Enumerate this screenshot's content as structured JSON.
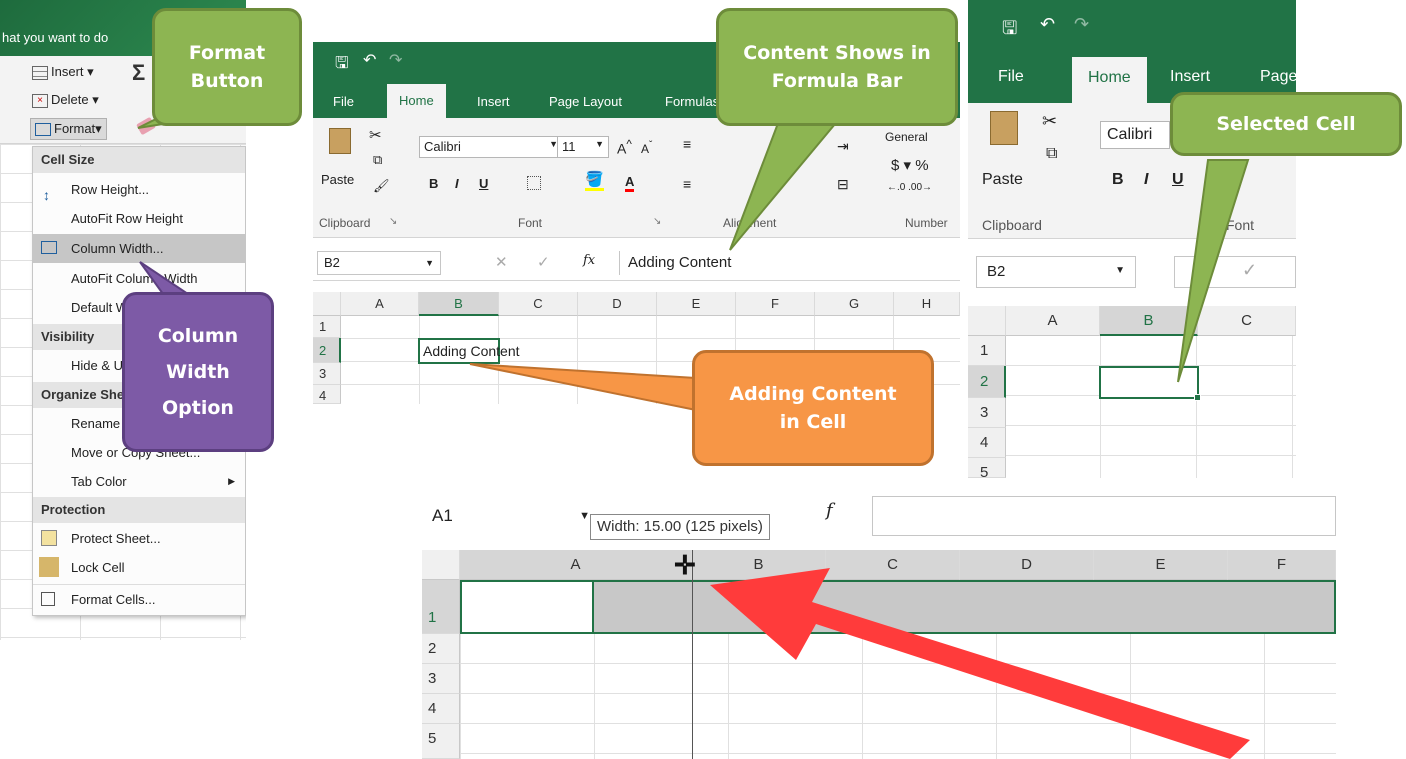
{
  "panel1": {
    "tellme": "hat you want to do",
    "insert_label": "Insert",
    "delete_label": "Delete",
    "format_label": "Format",
    "menu": {
      "cell_size": "Cell Size",
      "row_height": "Row Height...",
      "autofit_row": "AutoFit Row Height",
      "column_width": "Column Width...",
      "autofit_col": "AutoFit Column Width",
      "default_width": "Default Width...",
      "visibility": "Visibility",
      "hide_unhide": "Hide & Unhide",
      "organize": "Organize Sheets",
      "rename": "Rename Sheet",
      "move_copy": "Move or Copy Sheet...",
      "tab_color": "Tab Color",
      "protection": "Protection",
      "protect_sheet": "Protect Sheet...",
      "lock_cell": "Lock Cell",
      "format_cells": "Format Cells..."
    }
  },
  "panel2": {
    "tabs": [
      "File",
      "Home",
      "Insert",
      "Page Layout",
      "Formulas"
    ],
    "paste": "Paste",
    "font_name": "Calibri",
    "font_size": "11",
    "number_format": "General",
    "groups": {
      "clipboard": "Clipboard",
      "font": "Font",
      "alignment": "Alignment",
      "number": "Number"
    },
    "name_box": "B2",
    "formula": "Adding Content",
    "columns": [
      "A",
      "B",
      "C",
      "D",
      "E",
      "F",
      "G",
      "H"
    ],
    "rows": [
      "1",
      "2",
      "3",
      "4"
    ],
    "cell_b2": "Adding Content"
  },
  "panel3": {
    "tabs": [
      "File",
      "Home",
      "Insert",
      "Page"
    ],
    "paste": "Paste",
    "font_name": "Calibri",
    "clipboard": "Clipboard",
    "font_group": "Font",
    "name_box": "B2",
    "columns": [
      "A",
      "B",
      "C"
    ],
    "rows": [
      "1",
      "2",
      "3",
      "4",
      "5"
    ]
  },
  "panel4": {
    "name_box": "A1",
    "tooltip": "Width: 15.00 (125 pixels)",
    "columns": [
      "A",
      "B",
      "C",
      "D",
      "E",
      "F"
    ],
    "rows": [
      "1",
      "2",
      "3",
      "4",
      "5"
    ]
  },
  "callouts": {
    "format_button": "Format Button",
    "column_width": "Column Width Option",
    "content_formula": "Content Shows in Formula Bar",
    "selected_cell": "Selected Cell",
    "adding_content": "Adding Content in Cell"
  },
  "colors": {
    "excel_green": "#217346",
    "callout_green": "#8db552",
    "callout_purple": "#7d5aa6",
    "callout_orange": "#f79646",
    "arrow_red": "#ff3b3b"
  }
}
